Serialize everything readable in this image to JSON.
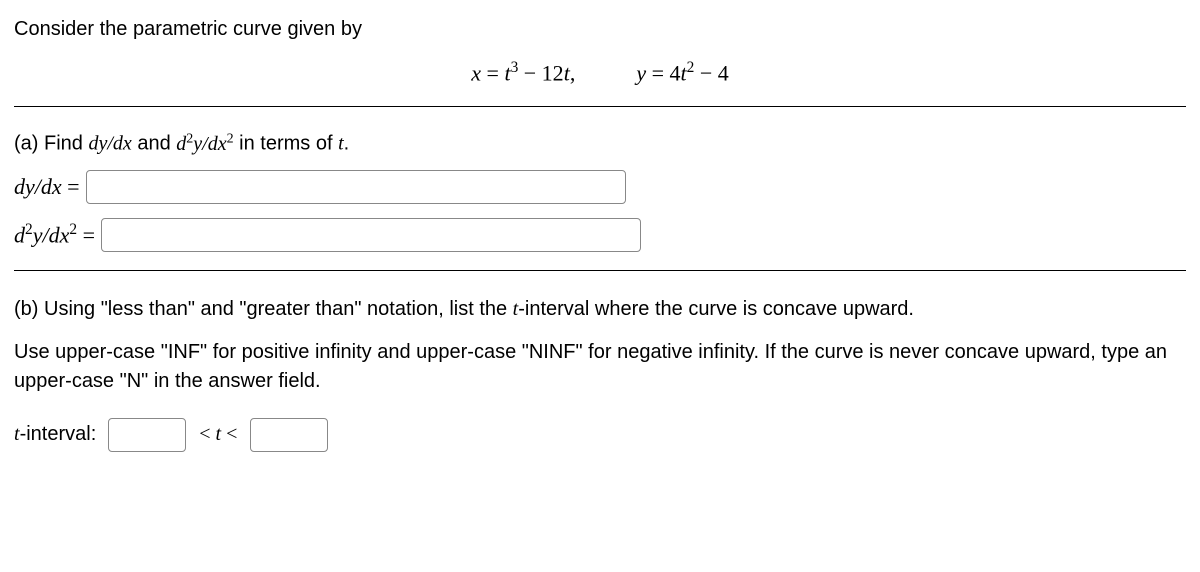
{
  "intro": "Consider the parametric curve given by",
  "equations": {
    "x_lhs": "x",
    "x_rhs_base": "t",
    "x_rhs_exp": "3",
    "x_rhs_tail": " − 12t,",
    "y_lhs": "y",
    "y_rhs_coef": "4",
    "y_rhs_base": "t",
    "y_rhs_exp": "2",
    "y_rhs_tail": " − 4"
  },
  "partA": {
    "prompt_prefix": "(a) Find ",
    "dy_dx": "dy/dx",
    "and": " and ",
    "d2y_dx2_pre": "d",
    "d2y_dx2_sup1": "2",
    "d2y_dx2_mid": "y/dx",
    "d2y_dx2_sup2": "2",
    "prompt_suffix": " in terms of ",
    "t": "t",
    "period": ".",
    "row1_label": "dy/dx",
    "row2_label_pre": "d",
    "row2_label_sup1": "2",
    "row2_label_mid": "y/dx",
    "row2_label_sup2": "2",
    "equals": " = "
  },
  "partB": {
    "line1_pre": "(b) Using \"less than\" and \"greater than\" notation, list the ",
    "t": "t",
    "line1_post": "-interval where the curve is concave upward.",
    "line2": "Use upper-case \"INF\" for positive infinity and upper-case \"NINF\" for negative infinity. If the curve is never concave upward, type an upper-case \"N\" in the answer field.",
    "interval_label_pre": "t",
    "interval_label_post": "-interval:",
    "lt_t_lt": " < t < "
  }
}
